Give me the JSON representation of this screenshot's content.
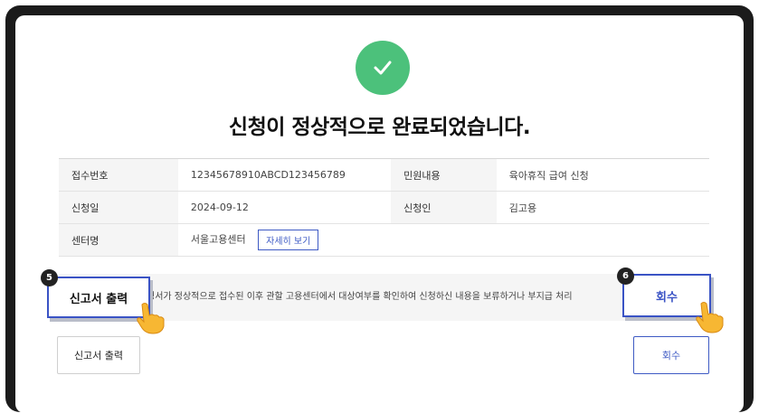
{
  "title": "신청이 정상적으로 완료되었습니다.",
  "icons": {
    "success": "check-icon",
    "pointer": "hand-pointer-icon"
  },
  "colors": {
    "success": "#4cc17b",
    "accent": "#3e5ac4",
    "badge": "#222222"
  },
  "info": {
    "receipt_no_label": "접수번호",
    "receipt_no_value": "12345678910ABCD123456789",
    "civil_content_label": "민원내용",
    "civil_content_value": "육아휴직 급여 신청",
    "apply_date_label": "신청일",
    "apply_date_value": "2024-09-12",
    "applicant_label": "신청인",
    "applicant_value": "김고용",
    "center_label": "센터명",
    "center_value": "서울고용센터",
    "detail_button": "자세히 보기"
  },
  "notice": {
    "text": "청서가 정상적으로 접수된 이후 관할 고용센터에서 대상여부를 확인하여 신청하신 내용을 보류하거나 부지급 처리"
  },
  "callouts": {
    "print": {
      "badge": "5",
      "label": "신고서 출력"
    },
    "collect": {
      "badge": "6",
      "label": "회수"
    }
  },
  "buttons": {
    "print": "신고서 출력",
    "collect": "회수"
  }
}
